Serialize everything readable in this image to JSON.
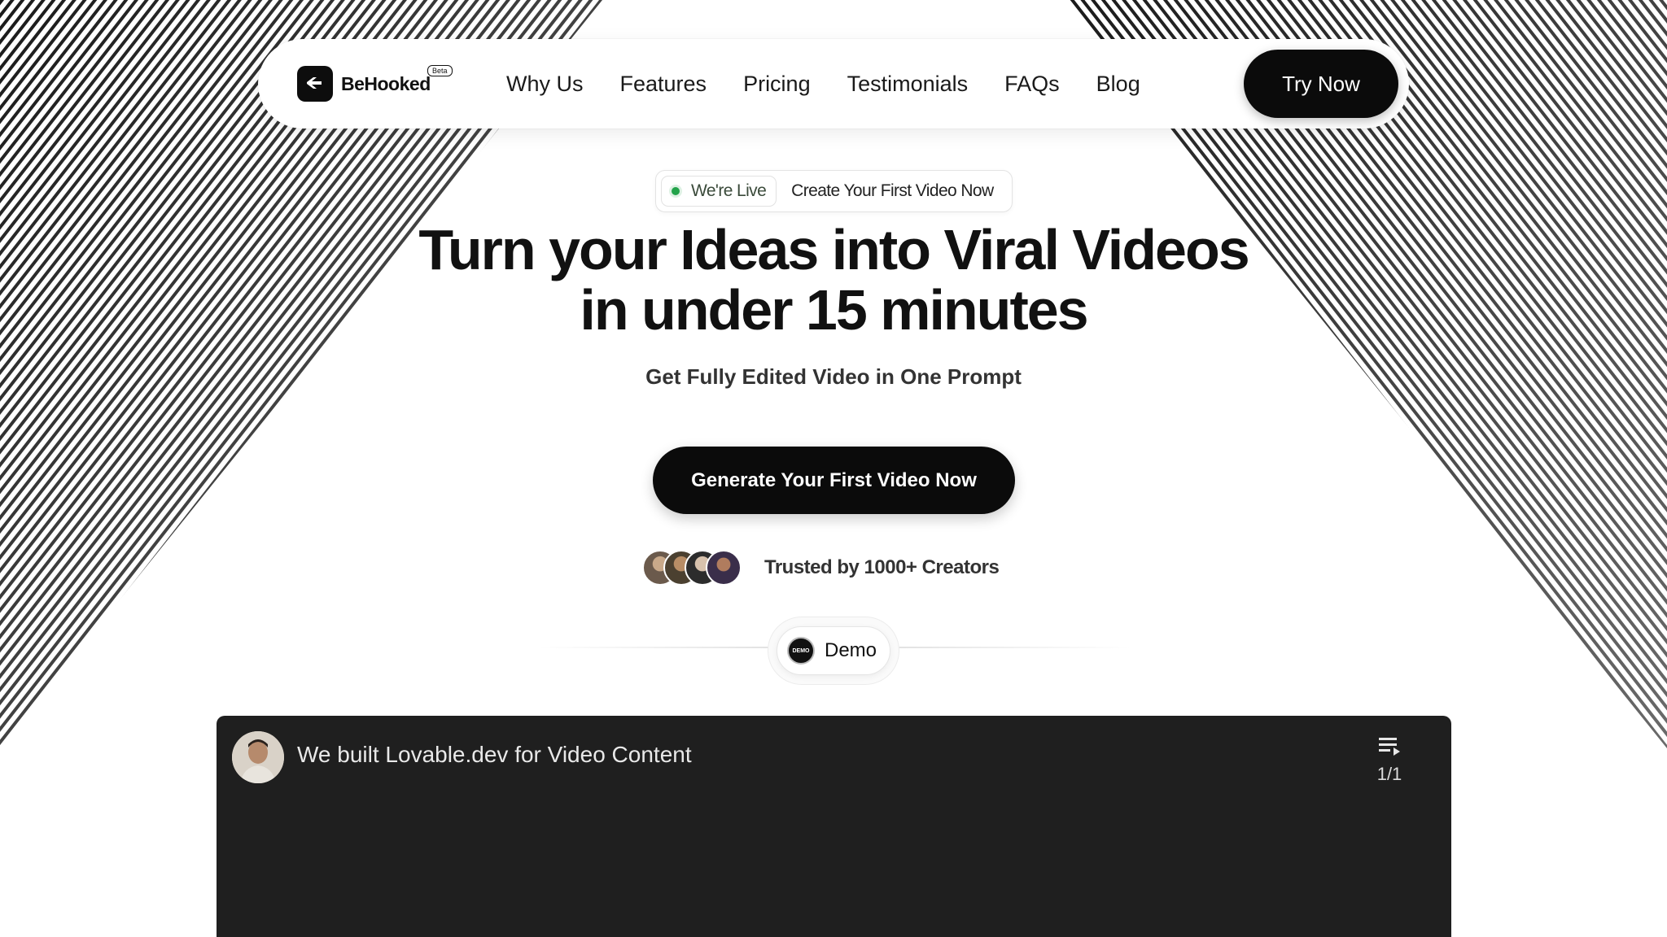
{
  "brand": {
    "name": "BeHooked",
    "badge": "Beta"
  },
  "nav": {
    "links": [
      "Why Us",
      "Features",
      "Pricing",
      "Testimonials",
      "FAQs",
      "Blog"
    ],
    "cta": "Try Now"
  },
  "hero": {
    "live_tag": "We're Live",
    "live_cta": "Create Your First Video Now",
    "title_line1": "Turn your Ideas into Viral Videos",
    "title_line2": "in under 15 minutes",
    "subtitle": "Get Fully Edited Video in One Prompt",
    "generate_button": "Generate Your First Video Now",
    "trusted_text": "Trusted by 1000+ Creators"
  },
  "demo": {
    "icon_text": "DEMO",
    "label": "Demo"
  },
  "video": {
    "title": "We built Lovable.dev for Video Content",
    "playlist_count": "1/1"
  },
  "colors": {
    "primary": "#0b0b0b",
    "live_dot": "#22a34a",
    "video_bg": "#1f1f1f"
  }
}
